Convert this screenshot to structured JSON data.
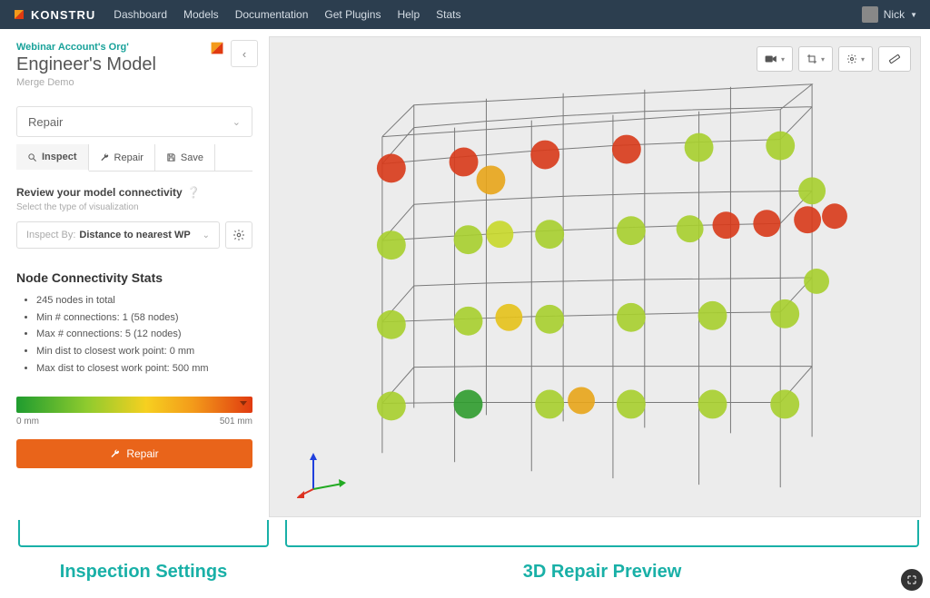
{
  "nav": {
    "brand": "KONSTRU",
    "links": [
      "Dashboard",
      "Models",
      "Documentation",
      "Get Plugins",
      "Help",
      "Stats"
    ],
    "user_name": "Nick"
  },
  "sidebar": {
    "breadcrumb": "Webinar Account's Org'",
    "title": "Engineer's Model",
    "subtitle": "Merge Demo",
    "mode_select": "Repair",
    "tabs": {
      "inspect": "Inspect",
      "repair": "Repair",
      "save": "Save"
    },
    "review_heading": "Review your model connectivity",
    "review_sub": "Select the type of visualization",
    "inspect_by_label": "Inspect By:",
    "inspect_by_value": "Distance to nearest WP",
    "stats_heading": "Node Connectivity Stats",
    "stats": [
      "245 nodes in total",
      "Min # connections: 1 (58 nodes)",
      "Max # connections: 5 (12 nodes)",
      "Min dist to closest work point: 0 mm",
      "Max dist to closest work point: 500 mm"
    ],
    "legend_min": "0 mm",
    "legend_max": "501 mm",
    "repair_button": "Repair"
  },
  "annotations": {
    "left": "Inspection Settings",
    "right": "3D Repair Preview"
  },
  "colors": {
    "teal": "#19b0a7",
    "orange": "#e9641a",
    "navbg": "#2c3e4f"
  },
  "viewport": {
    "description": "3D wireframe structural grid with colored node spheres (green→yellow→red) indicating distance to nearest work point",
    "axis_colors": {
      "x": "#d43",
      "y": "#2a2",
      "z": "#24d"
    }
  }
}
